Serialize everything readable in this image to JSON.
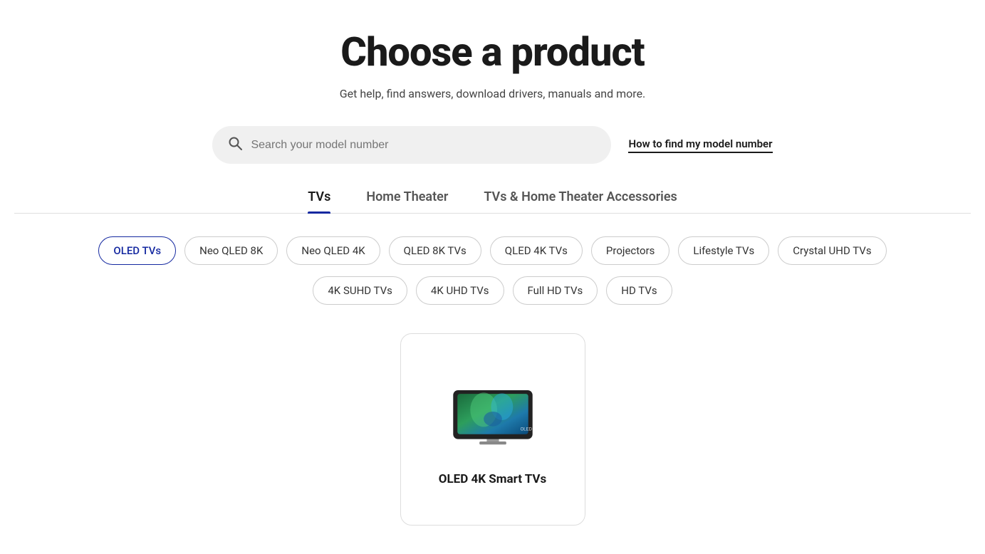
{
  "page": {
    "title": "Choose a product",
    "subtitle": "Get help, find answers, download drivers, manuals and more."
  },
  "search": {
    "placeholder": "Search your model number",
    "find_model_label": "How to find my model number"
  },
  "tabs": [
    {
      "id": "tvs",
      "label": "TVs",
      "active": true
    },
    {
      "id": "home-theater",
      "label": "Home Theater",
      "active": false
    },
    {
      "id": "accessories",
      "label": "TVs & Home Theater Accessories",
      "active": false
    }
  ],
  "chips_row1": [
    {
      "id": "oled-tvs",
      "label": "OLED TVs",
      "active": true
    },
    {
      "id": "neo-qled-8k",
      "label": "Neo QLED 8K",
      "active": false
    },
    {
      "id": "neo-qled-4k",
      "label": "Neo QLED 4K",
      "active": false
    },
    {
      "id": "qled-8k-tvs",
      "label": "QLED 8K TVs",
      "active": false
    },
    {
      "id": "qled-4k-tvs",
      "label": "QLED 4K TVs",
      "active": false
    },
    {
      "id": "projectors",
      "label": "Projectors",
      "active": false
    },
    {
      "id": "lifestyle-tvs",
      "label": "Lifestyle TVs",
      "active": false
    },
    {
      "id": "crystal-uhd-tvs",
      "label": "Crystal UHD TVs",
      "active": false
    }
  ],
  "chips_row2": [
    {
      "id": "4k-suhd-tvs",
      "label": "4K SUHD TVs",
      "active": false
    },
    {
      "id": "4k-uhd-tvs",
      "label": "4K UHD TVs",
      "active": false
    },
    {
      "id": "full-hd-tvs",
      "label": "Full HD TVs",
      "active": false
    },
    {
      "id": "hd-tvs",
      "label": "HD TVs",
      "active": false
    }
  ],
  "product_card": {
    "label": "OLED 4K Smart TVs"
  },
  "colors": {
    "accent": "#1428a0",
    "tab_active_underline": "#1428a0"
  }
}
